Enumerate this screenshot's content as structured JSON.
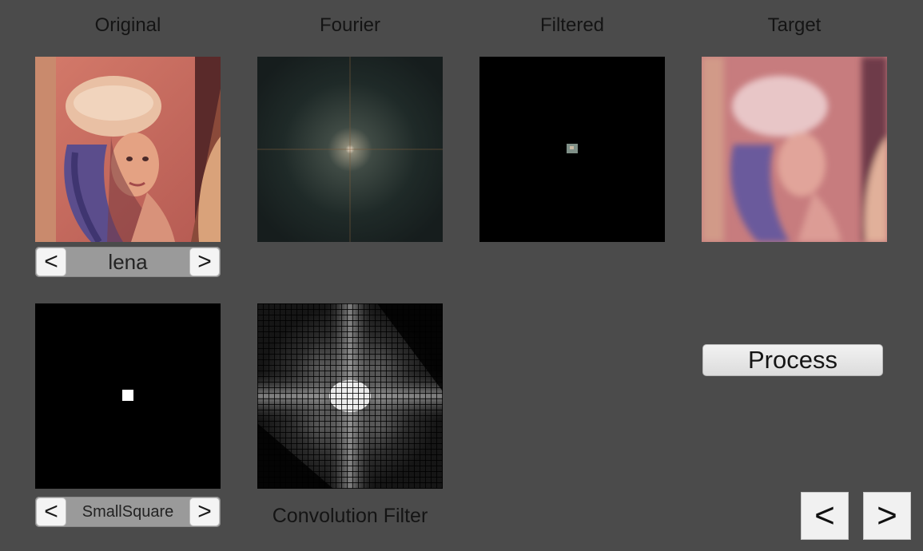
{
  "columns": {
    "original": "Original",
    "fourier": "Fourier",
    "filtered": "Filtered",
    "target": "Target"
  },
  "image_selector": {
    "prev_label": "<",
    "value": "lena",
    "next_label": ">"
  },
  "filter_selector": {
    "prev_label": "<",
    "value": "SmallSquare",
    "next_label": ">"
  },
  "convolution_caption": "Convolution Filter",
  "process_label": "Process",
  "nav": {
    "prev_label": "<",
    "next_label": ">"
  },
  "icons": {
    "original_image": "lena-portrait-image",
    "fourier_image": "fourier-spectrum-image",
    "filtered_image": "filtered-spectrum-image",
    "target_image": "blurred-lena-image",
    "filter_image": "small-square-filter-image",
    "convolution_image": "convolution-filter-image"
  }
}
